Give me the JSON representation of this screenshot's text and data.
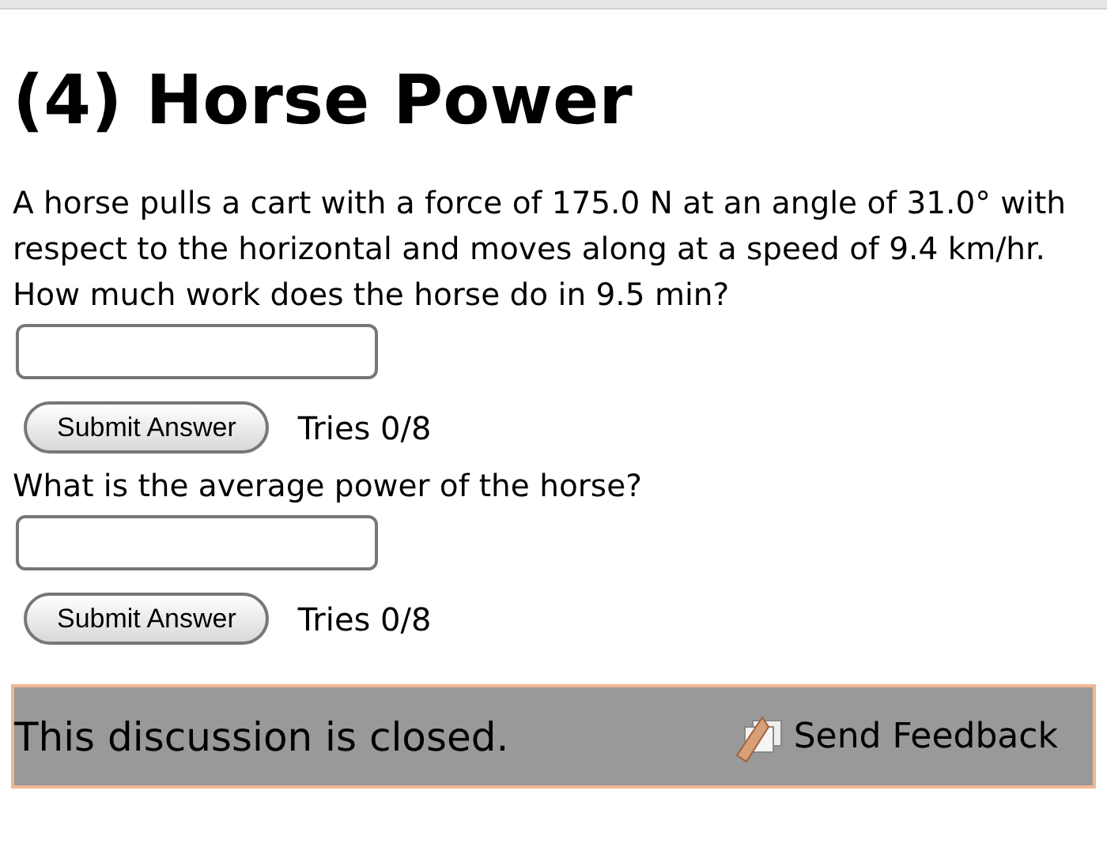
{
  "title": "(4) Horse Power",
  "questions": [
    {
      "prompt": "A horse pulls a cart with a force of 175.0 N at an angle of 31.0° with respect to the horizontal and moves along at a speed of 9.4 km/hr. How much work does the horse do in 9.5 min?",
      "button": "Submit Answer",
      "tries": "Tries 0/8"
    },
    {
      "prompt": "What is the average power of the horse?",
      "button": "Submit Answer",
      "tries": "Tries 0/8"
    }
  ],
  "footer": {
    "status": "This discussion is closed.",
    "feedback": "Send Feedback"
  }
}
